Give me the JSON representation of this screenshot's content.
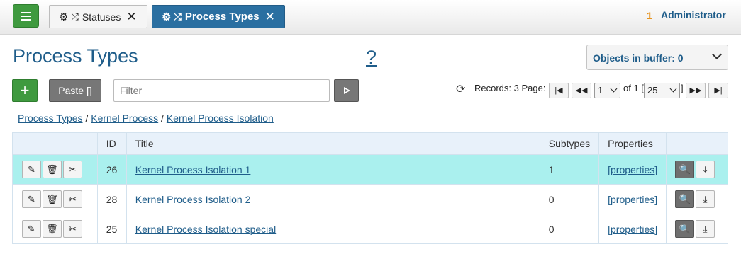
{
  "topbar": {
    "tabs": [
      {
        "label": "Statuses",
        "active": false
      },
      {
        "label": "Process Types",
        "active": true
      }
    ],
    "notification_count": "1",
    "user": "Administrator"
  },
  "header": {
    "title": "Process Types",
    "help": "?",
    "buffer_label": "Objects in buffer: 0"
  },
  "toolbar": {
    "add": "+",
    "paste": "Paste []",
    "filter_placeholder": "Filter",
    "filter_value": ""
  },
  "pager": {
    "records_label": "Records: 3 Page:",
    "page": "1",
    "of_label": "of 1 [",
    "page_size": "25",
    "close_bracket": "]"
  },
  "breadcrumb": [
    "Process Types",
    "Kernel Process",
    "Kernel Process Isolation"
  ],
  "table": {
    "columns": [
      "",
      "ID",
      "Title",
      "Subtypes",
      "Properties",
      ""
    ],
    "rows": [
      {
        "id": "26",
        "title": "Kernel Process Isolation 1",
        "subtypes": "1",
        "properties": "[properties]",
        "highlighted": true
      },
      {
        "id": "28",
        "title": "Kernel Process Isolation 2",
        "subtypes": "0",
        "properties": "[properties]",
        "highlighted": false
      },
      {
        "id": "25",
        "title": "Kernel Process Isolation special",
        "subtypes": "0",
        "properties": "[properties]",
        "highlighted": false
      }
    ]
  },
  "icons": {
    "menu": "hamburger-icon",
    "tab": [
      "gear-icon",
      "shuffle-icon",
      "close-icon"
    ],
    "pager": [
      "refresh-icon",
      "first-page-icon",
      "prev-page-icon",
      "next-page-icon",
      "last-page-icon"
    ],
    "row_actions": [
      "pencil-icon",
      "trash-icon",
      "scissors-icon"
    ],
    "row_side": [
      "search-icon",
      "download-icon"
    ]
  },
  "colors": {
    "accent": "#1f5d8a",
    "active_tab": "#2a6fa1",
    "green": "#3f9a3f",
    "highlight_row": "#aaf0ee",
    "header_row": "#e8f1fa"
  }
}
